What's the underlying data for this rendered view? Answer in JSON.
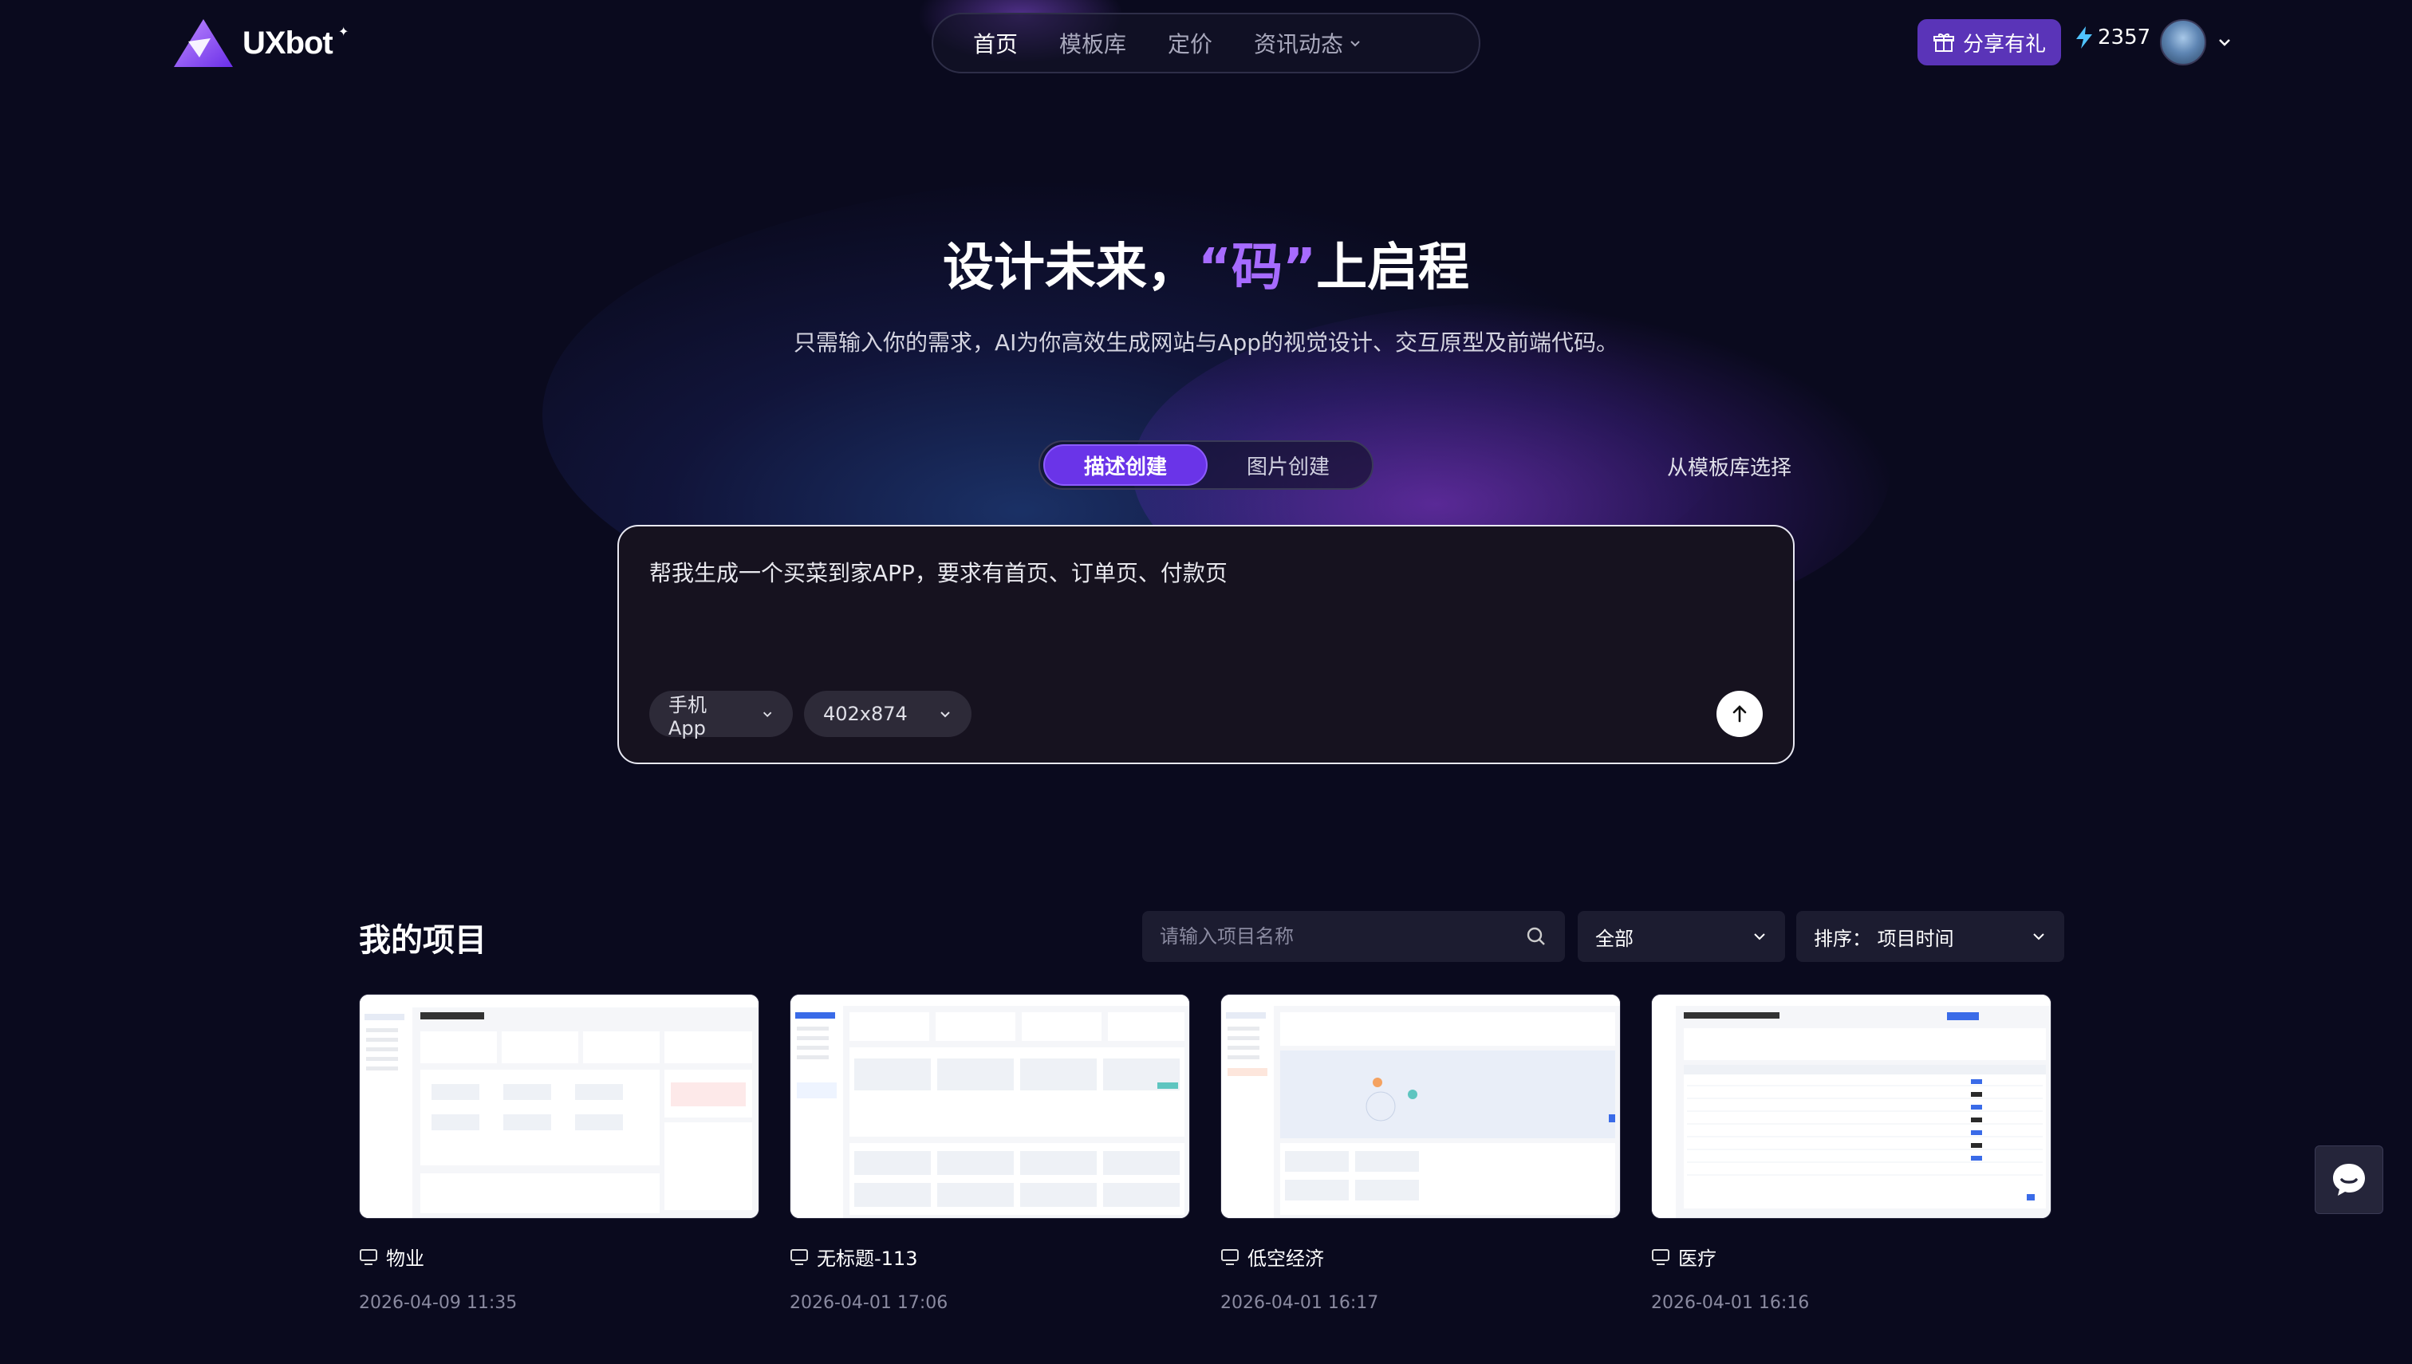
{
  "brand": {
    "name": "UXbot"
  },
  "nav": {
    "items": [
      {
        "label": "首页",
        "active": true
      },
      {
        "label": "模板库",
        "active": false
      },
      {
        "label": "定价",
        "active": false
      },
      {
        "label": "资讯动态",
        "active": false
      }
    ]
  },
  "header": {
    "gift_label": "分享有礼",
    "credits": "2357"
  },
  "hero": {
    "title_before": "设计未来，",
    "title_highlight": "“码”",
    "title_after": "上启程",
    "subtitle": "只需输入你的需求，AI为你高效生成网站与App的视觉设计、交互原型及前端代码。"
  },
  "mode_tabs": [
    {
      "label": "描述创建",
      "active": true
    },
    {
      "label": "图片创建",
      "active": false
    }
  ],
  "from_template_label": "从模板库选择",
  "prompt": {
    "value": "帮我生成一个买菜到家APP，要求有首页、订单页、付款页",
    "device": "手机App",
    "size": "402x874"
  },
  "projects": {
    "title": "我的项目",
    "search_placeholder": "请输入项目名称",
    "filter_value": "全部",
    "sort_label": "排序：",
    "sort_value": "项目时间",
    "items": [
      {
        "name": "物业",
        "date": "2026-04-09 11:35"
      },
      {
        "name": "无标题-113",
        "date": "2026-04-01 17:06"
      },
      {
        "name": "低空经济",
        "date": "2026-04-01 16:17"
      },
      {
        "name": "医疗",
        "date": "2026-04-01 16:16"
      }
    ]
  },
  "colors": {
    "accent": "#6a34e8",
    "highlight": "#a66bff",
    "background": "#0a0a1e"
  }
}
